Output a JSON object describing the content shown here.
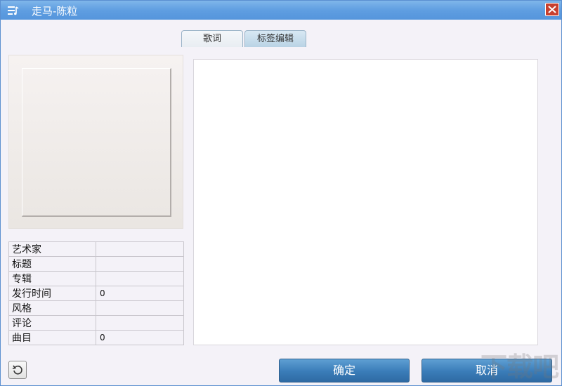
{
  "window": {
    "title": "走马-陈粒"
  },
  "tabs": [
    {
      "label": "歌词"
    },
    {
      "label": "标签编辑"
    }
  ],
  "info": {
    "rows": [
      {
        "key": "艺术家",
        "value": ""
      },
      {
        "key": "标题",
        "value": ""
      },
      {
        "key": "专辑",
        "value": ""
      },
      {
        "key": "发行时间",
        "value": "0"
      },
      {
        "key": "风格",
        "value": ""
      },
      {
        "key": "评论",
        "value": ""
      },
      {
        "key": "曲目",
        "value": "0"
      }
    ]
  },
  "lyrics": {
    "text": ""
  },
  "buttons": {
    "ok": "确定",
    "cancel": "取消"
  },
  "icons": {
    "app": "lyrics-menu-icon",
    "close": "close-icon",
    "refresh": "refresh-icon"
  },
  "colors": {
    "titlebar": "#5f9ee1",
    "close": "#c8402f",
    "button": "#3a7cb8"
  },
  "watermark": "下载吧"
}
